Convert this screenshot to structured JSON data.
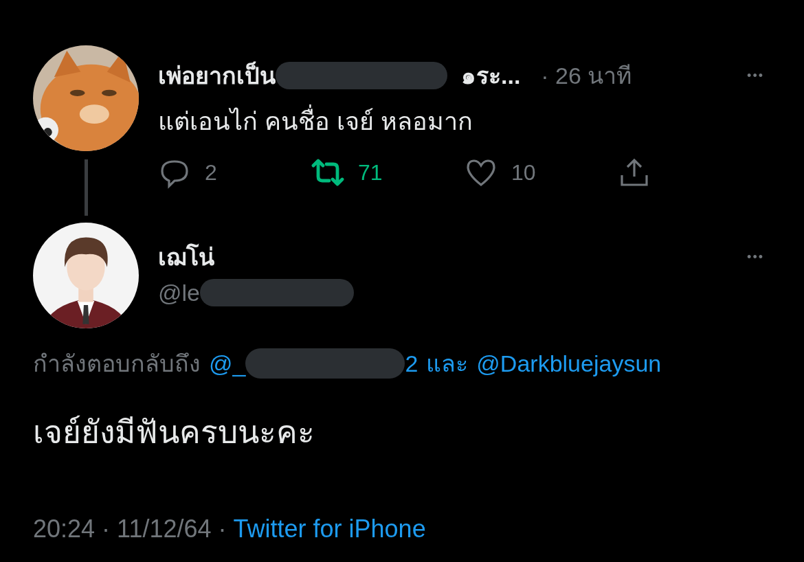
{
  "parent_tweet": {
    "name_parts": [
      "เพ่อยากเป็น",
      "๑ระ..."
    ],
    "time": "· 26 นาที",
    "more": "•••",
    "text": "แต่เอนไก่ คนชื่อ เจย์ หลอมาก",
    "actions": [
      {
        "kind": "reply",
        "count": "2",
        "active": false
      },
      {
        "kind": "retweet",
        "count": "71",
        "active": true
      },
      {
        "kind": "like",
        "count": "10",
        "active": false
      },
      {
        "kind": "share",
        "active": false
      }
    ]
  },
  "tweet": {
    "name": "เฌโน่",
    "more": "•••",
    "handle": "@le",
    "replying_to": {
      "label": "กำลังตอบกลับถึง",
      "mention_parts": [
        "@_",
        "2"
      ],
      "joiner": "และ",
      "mention": "@Darkbluejaysun"
    },
    "text": "เจย์ยังมีฟันครบนะคะ",
    "timestamp": "20:24 · 11/12/64 ·",
    "source": "Twitter for iPhone"
  }
}
